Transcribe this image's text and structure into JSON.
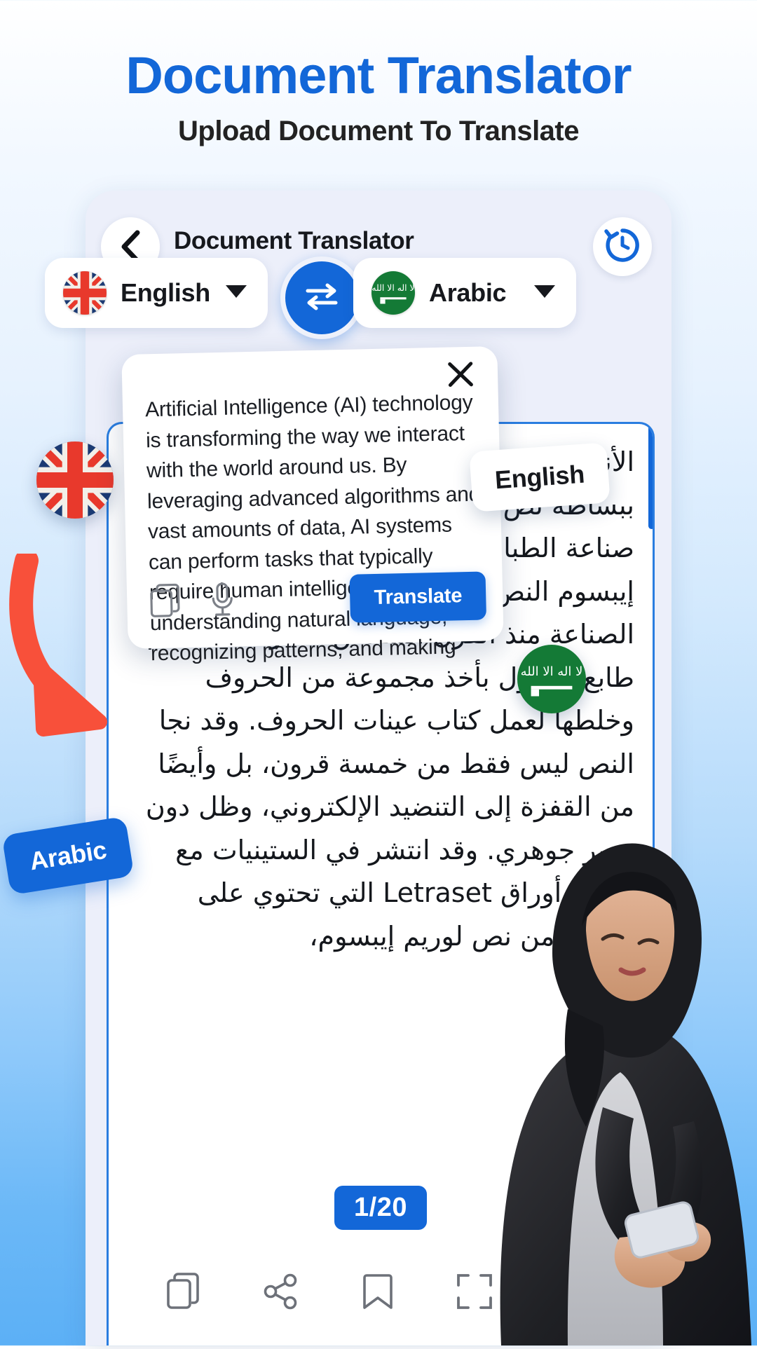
{
  "promo": {
    "title": "Document Translator",
    "subtitle": "Upload Document To Translate"
  },
  "app": {
    "appbar": {
      "title": "Document Translator",
      "back_icon": "chevron-left-icon",
      "history_icon": "history-clock-icon"
    },
    "language_bar": {
      "source": {
        "label": "English",
        "flag": "uk-flag",
        "caret": "chevron-down-icon"
      },
      "target": {
        "label": "Arabic",
        "flag": "saudi-arabia-flag",
        "caret": "chevron-down-icon"
      },
      "swap_icon": "swap-horizontal-icon"
    },
    "popup": {
      "close_icon": "close-icon",
      "text": "Artificial Intelligence (AI) technology is transforming the way we interact with the world around us. By leveraging advanced algorithms and vast amounts of data, AI systems can perform tasks that typically require human intelligence, such as understanding natural language, recognizing patterns, and making",
      "copy_icon": "copy-icon",
      "mic_icon": "microphone-icon",
      "translate_label": "Translate"
    },
    "document": {
      "text": "الأنماط وإجراء. إن نص لوريم إيبسوم هو ببساطة نص شكلي غير رسمي يستخدم في صناعة الطباعة والتنضيد. وقد كان نص لوريم إيبسوم النص الشكلي القياسي في هذه الصناعة منذ القرن السادس عشر، عندما قام طابع مجهول بأخذ مجموعة من الحروف وخلطها لعمل كتاب عينات الحروف. وقد نجا النص ليس فقط من خمسة قرون، بل وأيضًا من القفزة إلى التنضيد الإلكتروني، وظل دون تغيير جوهري. وقد انتشر في الستينيات مع إصدار أوراق Letraset التي تحتوي على مقاطع من نص لوريم إيبسوم،",
      "page_indicator": "1/20",
      "toolbar": [
        {
          "name": "copy-icon"
        },
        {
          "name": "share-icon"
        },
        {
          "name": "bookmark-icon"
        },
        {
          "name": "fullscreen-icon"
        },
        {
          "name": "speaker-icon"
        }
      ]
    }
  },
  "callouts": {
    "english": "English",
    "arabic": "Arabic"
  },
  "colors": {
    "brand_blue": "#1367d8",
    "arrow_red": "#f8503a",
    "flag_green": "#1a7a36",
    "page_bg_top": "#ffffff",
    "page_bg_bottom": "#5cb0f6"
  }
}
